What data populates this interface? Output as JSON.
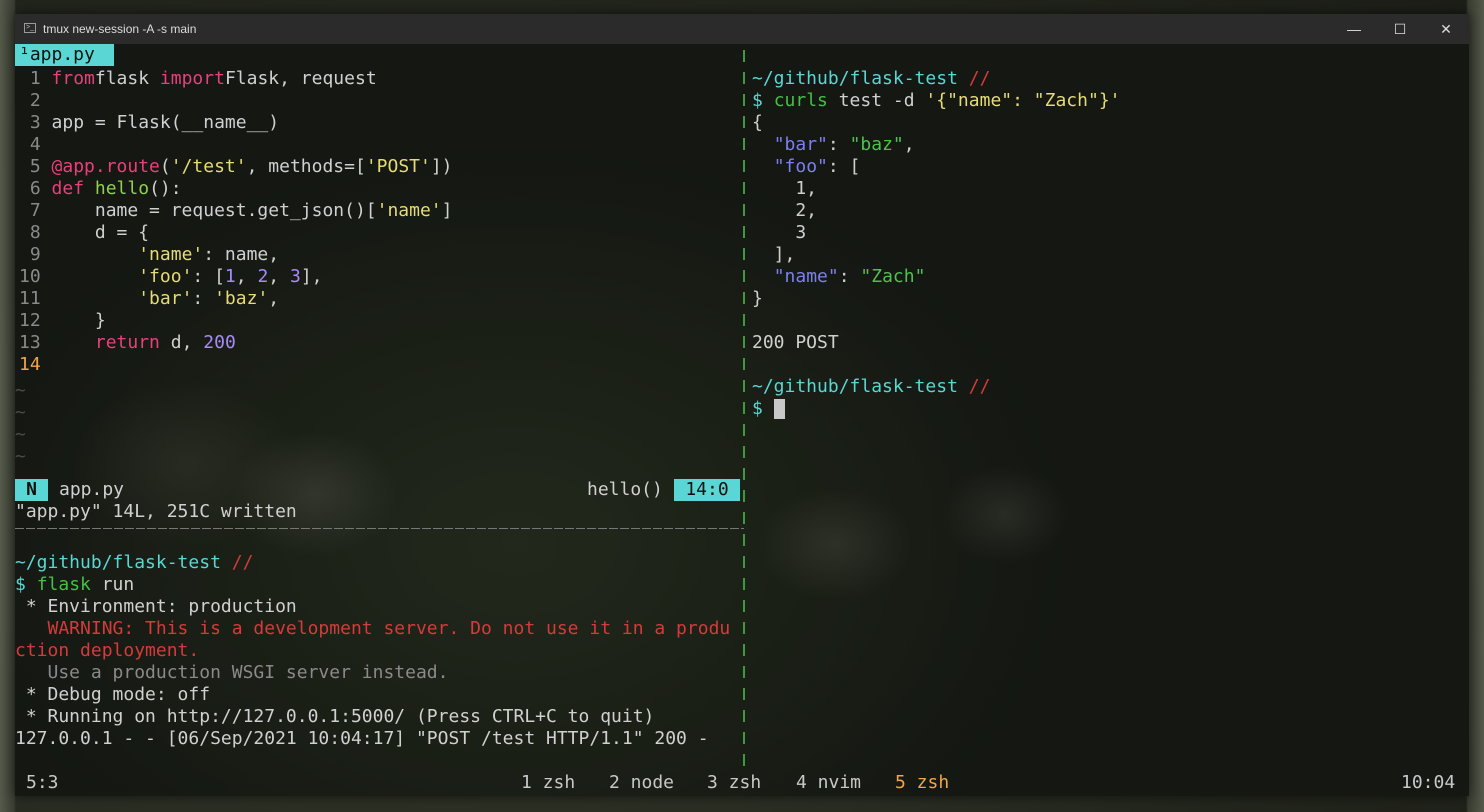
{
  "window": {
    "title": "tmux new-session -A -s main",
    "minimize": "—",
    "maximize": "☐",
    "close": "✕"
  },
  "editor": {
    "tab_label": "¹app.py",
    "code": [
      {
        "n": " 1",
        "t": [
          [
            "kw",
            "from"
          ],
          [
            "",
            "flask "
          ],
          [
            "kw",
            "import"
          ],
          [
            "",
            "Flask, request"
          ]
        ]
      },
      {
        "n": " 2",
        "t": []
      },
      {
        "n": " 3",
        "t": [
          [
            "",
            "app = Flask(__name__)"
          ]
        ]
      },
      {
        "n": " 4",
        "t": []
      },
      {
        "n": " 5",
        "t": [
          [
            "deco",
            "@app.route"
          ],
          [
            "",
            "("
          ],
          [
            "str",
            "'/test'"
          ],
          [
            "",
            ", methods=["
          ],
          [
            "str",
            "'POST'"
          ],
          [
            "",
            "])"
          ]
        ]
      },
      {
        "n": " 6",
        "t": [
          [
            "kw",
            "def "
          ],
          [
            "fn",
            "hello"
          ],
          [
            "",
            "():"
          ]
        ]
      },
      {
        "n": " 7",
        "t": [
          [
            "",
            "    name = request.get_json()["
          ],
          [
            "str",
            "'name'"
          ],
          [
            "",
            "]"
          ]
        ]
      },
      {
        "n": " 8",
        "t": [
          [
            "",
            "    d = {"
          ]
        ]
      },
      {
        "n": " 9",
        "t": [
          [
            "",
            "        "
          ],
          [
            "str",
            "'name'"
          ],
          [
            "",
            ": name,"
          ]
        ]
      },
      {
        "n": "10",
        "t": [
          [
            "",
            "        "
          ],
          [
            "str",
            "'foo'"
          ],
          [
            "",
            ": ["
          ],
          [
            "num",
            "1"
          ],
          [
            "",
            ", "
          ],
          [
            "num",
            "2"
          ],
          [
            "",
            ", "
          ],
          [
            "num",
            "3"
          ],
          [
            "",
            "],"
          ]
        ]
      },
      {
        "n": "11",
        "t": [
          [
            "",
            "        "
          ],
          [
            "str",
            "'bar'"
          ],
          [
            "",
            ": "
          ],
          [
            "str",
            "'baz'"
          ],
          [
            "",
            ","
          ]
        ]
      },
      {
        "n": "12",
        "t": [
          [
            "",
            "    }"
          ]
        ]
      },
      {
        "n": "13",
        "t": [
          [
            "",
            "    "
          ],
          [
            "kw",
            "return"
          ],
          [
            "",
            " d, "
          ],
          [
            "num",
            "200"
          ]
        ]
      },
      {
        "n": "14",
        "t": []
      }
    ],
    "tilde": "~",
    "mode": "N",
    "filename": "app.py",
    "function": "hello()",
    "position": "14:0",
    "message": "\"app.py\" 14L, 251C written"
  },
  "bottom_pane": {
    "lines": [
      [
        [
          "cyan",
          "~/github/flask-test "
        ],
        [
          "red",
          "//"
        ]
      ],
      [
        [
          "cyan",
          "$ "
        ],
        [
          "green",
          "flask"
        ],
        [
          "",
          " run"
        ]
      ],
      [
        [
          "",
          " * Environment: production"
        ]
      ],
      [
        [
          "red",
          "   WARNING: This is a development server. Do not use it in a produ"
        ]
      ],
      [
        [
          "red",
          "ction deployment."
        ]
      ],
      [
        [
          "dim",
          "   Use a production WSGI server instead."
        ]
      ],
      [
        [
          "",
          " * Debug mode: off"
        ]
      ],
      [
        [
          "",
          " * Running on http://127.0.0.1:5000/ (Press CTRL+C to quit)"
        ]
      ],
      [
        [
          "",
          "127.0.0.1 - - [06/Sep/2021 10:04:17] \"POST /test HTTP/1.1\" 200 -"
        ]
      ]
    ]
  },
  "right_pane": {
    "lines": [
      [
        [
          "cyan",
          "~/github/flask-test "
        ],
        [
          "red",
          "//"
        ]
      ],
      [
        [
          "cyan",
          "$ "
        ],
        [
          "green",
          "curls"
        ],
        [
          "",
          " test -d "
        ],
        [
          "str",
          "'{\"name\": \"Zach\"}'"
        ]
      ],
      [
        [
          "",
          "{"
        ]
      ],
      [
        [
          "",
          "  "
        ],
        [
          "blue",
          "\"bar\""
        ],
        [
          "",
          ": "
        ],
        [
          "jgreen",
          "\"baz\""
        ],
        [
          "",
          ","
        ]
      ],
      [
        [
          "",
          "  "
        ],
        [
          "blue",
          "\"foo\""
        ],
        [
          "",
          ": ["
        ]
      ],
      [
        [
          "",
          "    1,"
        ]
      ],
      [
        [
          "",
          "    2,"
        ]
      ],
      [
        [
          "",
          "    3"
        ]
      ],
      [
        [
          "",
          "  ],"
        ]
      ],
      [
        [
          "",
          "  "
        ],
        [
          "blue",
          "\"name\""
        ],
        [
          "",
          ": "
        ],
        [
          "jgreen",
          "\"Zach\""
        ]
      ],
      [
        [
          "",
          "}"
        ]
      ],
      [],
      [
        [
          "",
          "200 POST"
        ]
      ],
      [],
      [
        [
          "cyan",
          "~/github/flask-test "
        ],
        [
          "red",
          "//"
        ]
      ],
      [
        [
          "cyan",
          "$ "
        ]
      ]
    ]
  },
  "status": {
    "left": "5:3",
    "windows": [
      {
        "label": "1 zsh",
        "active": false
      },
      {
        "label": "2 node",
        "active": false
      },
      {
        "label": "3 zsh",
        "active": false
      },
      {
        "label": "4 nvim",
        "active": false
      },
      {
        "label": "5 zsh",
        "active": true
      }
    ],
    "clock": "10:04"
  }
}
